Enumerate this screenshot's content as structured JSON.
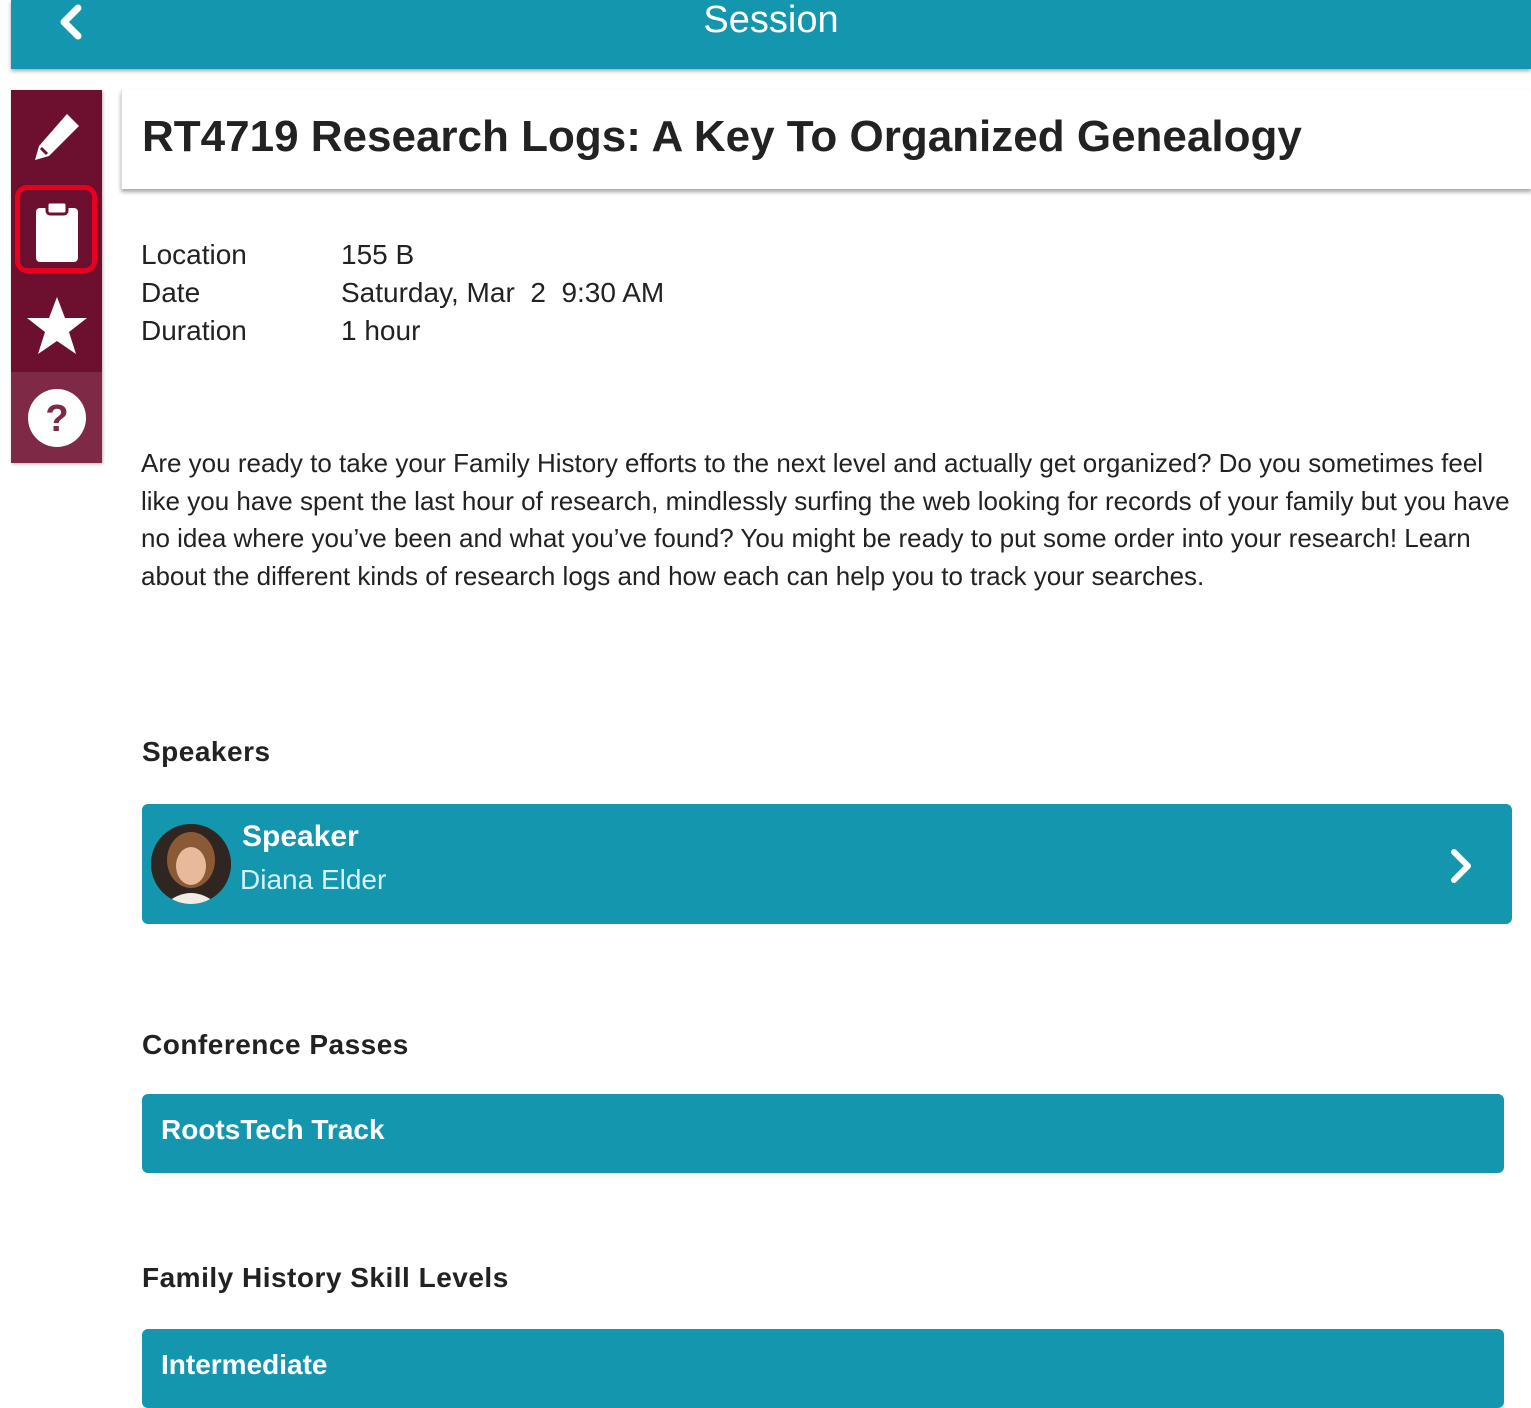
{
  "header": {
    "title": "Session",
    "back_icon": "chevron-left-icon"
  },
  "sidebar": {
    "items": [
      {
        "icon": "pencil-icon"
      },
      {
        "icon": "clipboard-icon",
        "highlighted": true
      },
      {
        "icon": "star-icon"
      },
      {
        "icon": "help-icon"
      }
    ]
  },
  "session": {
    "title": "RT4719 Research Logs: A Key To Organized Genealogy",
    "details": [
      {
        "label": "Location",
        "value": "155 B"
      },
      {
        "label": "Date",
        "value": "Saturday, Mar  2  9:30 AM"
      },
      {
        "label": "Duration",
        "value": "1 hour"
      }
    ],
    "description": "Are you ready to take your Family History efforts to the next level and actually get organized? Do you sometimes feel like you have spent the last hour of research, mindlessly surfing the web looking for records of your family but you have no idea where you’ve been and what you’ve found? You might be ready to put some order into your research! Learn about the different kinds of research logs and how each can help you to track your searches."
  },
  "speakers": {
    "heading": "Speakers",
    "items": [
      {
        "role": "Speaker",
        "name": "Diana Elder"
      }
    ]
  },
  "passes": {
    "heading": "Conference Passes",
    "items": [
      {
        "label": "RootsTech Track"
      }
    ]
  },
  "skill_levels": {
    "heading": "Family History Skill Levels",
    "items": [
      {
        "label": "Intermediate"
      }
    ]
  },
  "colors": {
    "header_bg": "#1497ae",
    "sidebar_bg": "#6d0f2f",
    "sidebar_help_bg": "#7e2a47",
    "highlight": "#e8001f",
    "card_bg": "#1497ae"
  }
}
